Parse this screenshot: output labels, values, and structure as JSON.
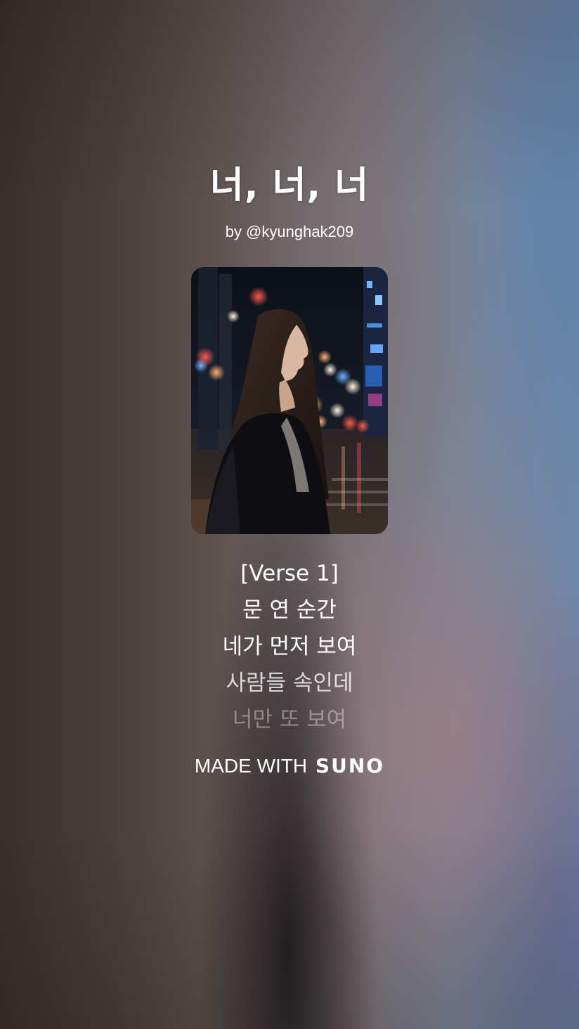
{
  "song": {
    "title": "너, 너, 너",
    "artist": "by @kyunghak209"
  },
  "cover": {
    "icon": "cover-art-image"
  },
  "lyrics": {
    "lines": [
      "[Verse 1]",
      "문 연 순간",
      "네가 먼저 보여",
      "사람들 속인데",
      "너만 또 보여"
    ]
  },
  "footer": {
    "prefix": "MADE WITH",
    "brand": "SUNO"
  },
  "colors": {
    "text": "#ffffff",
    "background_warm": "#4a3f3b",
    "background_cool": "#6f88a8"
  }
}
